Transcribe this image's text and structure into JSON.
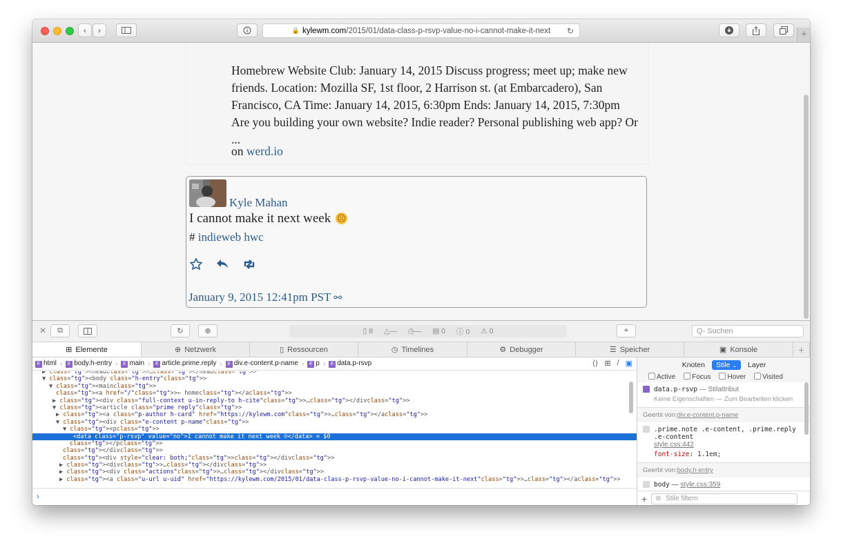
{
  "browser": {
    "url_host": "kylewm.com",
    "url_path": "/2015/01/data-class-p-rsvp-value-no-i-cannot-make-it-next"
  },
  "context": {
    "text": "Homebrew Website Club: January 14, 2015 Discuss progress; meet up; make new friends. Location: Mozilla SF, 1st floor, 2 Harrison st. (at Embarcadero), San Francisco, CA Time: January 14, 2015, 6:30pm Ends: January 14, 2015, 7:30pm Are you building your own website? Indie reader? Personal publishing web app? Or ...",
    "on_label": "on",
    "on_link": "werd.io"
  },
  "reply": {
    "author": "Kyle Mahan",
    "content": "I cannot make it next week",
    "emoji": "☹",
    "tags_prefix": "#",
    "tags": "indieweb hwc",
    "permalink": "January 9, 2015 12:41pm PST"
  },
  "devtools": {
    "status": {
      "resources": "8",
      "errors": "0",
      "warnings": "0",
      "logs": "0"
    },
    "search_placeholder": "Suchen",
    "tabs": [
      {
        "label": "Elemente",
        "icon": "elements-icon"
      },
      {
        "label": "Netzwerk",
        "icon": "network-icon"
      },
      {
        "label": "Ressourcen",
        "icon": "resources-icon"
      },
      {
        "label": "Timelines",
        "icon": "timelines-icon"
      },
      {
        "label": "Debugger",
        "icon": "debugger-icon"
      },
      {
        "label": "Speicher",
        "icon": "storage-icon"
      },
      {
        "label": "Konsole",
        "icon": "console-icon"
      }
    ],
    "breadcrumb": [
      "html",
      "body.h-entry",
      "main",
      "article.prime.reply",
      "div.e-content.p-name",
      "p",
      "data.p-rsvp"
    ],
    "dom": [
      {
        "indent": 2,
        "text": "▶ <head>…</head>"
      },
      {
        "indent": 2,
        "text": "▼ <body class=\"h-entry\">"
      },
      {
        "indent": 4,
        "text": "▼ <main>"
      },
      {
        "indent": 6,
        "text": "<a href=\"/\">← home</a>"
      },
      {
        "indent": 5,
        "text": "▶ <div class=\"full-context u-in-reply-to h-cite\">…</div>"
      },
      {
        "indent": 5,
        "text": "▼ <article class=\"prime reply\">"
      },
      {
        "indent": 6,
        "text": "▶ <a class=\"p-author h-card\" href=\"https://kylewm.com\">…</a>"
      },
      {
        "indent": 6,
        "text": "▼ <div class=\"e-content p-name\">"
      },
      {
        "indent": 8,
        "text": "▼ <p>"
      },
      {
        "indent": 11,
        "text": "<data class=\"p-rsvp\" value=\"no\">I cannot make it next week ☹</data> = $0",
        "selected": true
      },
      {
        "indent": 10,
        "text": "</p>"
      },
      {
        "indent": 8,
        "text": "</div>"
      },
      {
        "indent": 8,
        "text": "<div style=\"clear: both;\"></div>"
      },
      {
        "indent": 7,
        "text": "▶ <div>…</div>"
      },
      {
        "indent": 7,
        "text": "▶ <div class=\"actions\">…</div>"
      },
      {
        "indent": 7,
        "text": "▶ <a class=\"u-url u-uid\" href=\"https://kylewm.com/2015/01/data-class-p-rsvp-value-no-i-cannot-make-it-next\">…</a>"
      }
    ],
    "side": {
      "tabs": [
        "Knoten",
        "Stile",
        "Layer"
      ],
      "states": [
        "Active",
        "Focus",
        "Hover",
        "Visited"
      ],
      "rule1_selector": "data.p-rsvp",
      "rule1_origin": "— Stilattribut",
      "rule1_note": "Keine Eigenschaften — Zum Bearbeiten klicken",
      "inherited1_label": "Geerbt von:",
      "inherited1_src": "div.e-content.p-name",
      "rule2_selector": ".prime.note .e-content, .prime.reply .e-content",
      "rule2_source": "style.css:442",
      "rule2_prop": "font-size",
      "rule2_value": "1.1em;",
      "inherited2_label": "Geerbt von:",
      "inherited2_src": "body.h-entry",
      "rule3_selector": "body",
      "rule3_source": "style.css:359",
      "filter_placeholder": "Stile filtern"
    }
  }
}
